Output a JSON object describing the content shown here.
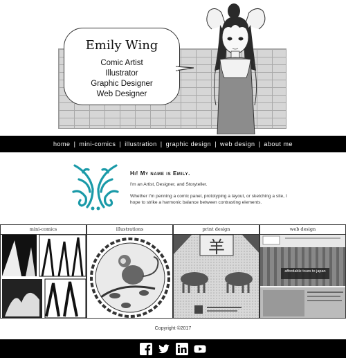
{
  "hero": {
    "name": "Emily Wing",
    "roles": [
      "Comic Artist",
      "Illustrator",
      "Graphic Designer",
      "Web Designer"
    ]
  },
  "nav": {
    "items": [
      "home",
      "mini-comics",
      "illustration",
      "graphic design",
      "web design",
      "about me"
    ],
    "separator": "|"
  },
  "intro": {
    "greeting": "Hi! My name is Emily.",
    "line1": "I'm an Artist, Designer, and Storyteller.",
    "line2": "Whether I'm penning a comic panel, prototyping a layout, or sketching a site, I hope to strike a harmonic balance between contrasting elements."
  },
  "gallery": {
    "tiles": [
      "mini-comics",
      "illustrations",
      "print design",
      "web design"
    ],
    "web_banner": "affordable tours to japan"
  },
  "footer": {
    "copyright": "Copyright ©2017",
    "social": [
      "facebook-icon",
      "twitter-icon",
      "linkedin-icon",
      "youtube-icon"
    ]
  },
  "colors": {
    "accent": "#1a9aa8",
    "nav_bg": "#000000",
    "footer_bg": "#000000"
  }
}
